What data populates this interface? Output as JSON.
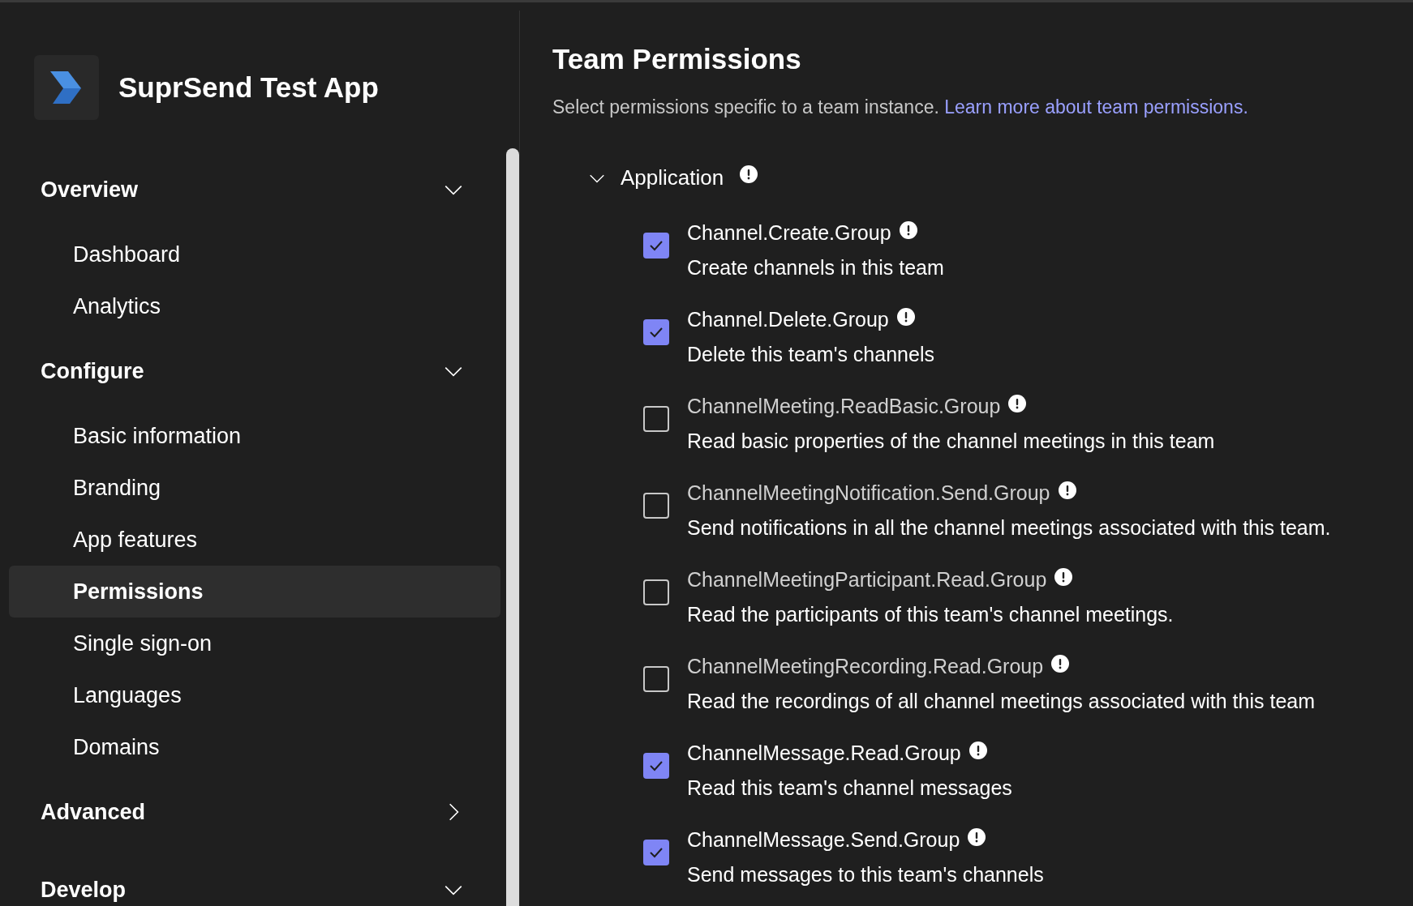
{
  "app": {
    "name": "SuprSend Test App"
  },
  "sidebar": {
    "sections": [
      {
        "label": "Overview",
        "expanded": true,
        "items": [
          {
            "label": "Dashboard",
            "selected": false
          },
          {
            "label": "Analytics",
            "selected": false
          }
        ]
      },
      {
        "label": "Configure",
        "expanded": true,
        "items": [
          {
            "label": "Basic information",
            "selected": false
          },
          {
            "label": "Branding",
            "selected": false
          },
          {
            "label": "App features",
            "selected": false
          },
          {
            "label": "Permissions",
            "selected": true
          },
          {
            "label": "Single sign-on",
            "selected": false
          },
          {
            "label": "Languages",
            "selected": false
          },
          {
            "label": "Domains",
            "selected": false
          }
        ]
      },
      {
        "label": "Advanced",
        "expanded": false
      },
      {
        "label": "Develop",
        "expanded": true
      }
    ]
  },
  "main": {
    "title": "Team Permissions",
    "description": "Select permissions specific to a team instance.",
    "link": "Learn more about team permissions.",
    "group": {
      "label": "Application",
      "expanded": true,
      "permissions": [
        {
          "name": "Channel.Create.Group",
          "description": "Create channels in this team",
          "checked": true
        },
        {
          "name": "Channel.Delete.Group",
          "description": "Delete this team's channels",
          "checked": true
        },
        {
          "name": "ChannelMeeting.ReadBasic.Group",
          "description": "Read basic properties of the channel meetings in this team",
          "checked": false
        },
        {
          "name": "ChannelMeetingNotification.Send.Group",
          "description": "Send notifications in all the channel meetings associated with this team.",
          "checked": false
        },
        {
          "name": "ChannelMeetingParticipant.Read.Group",
          "description": "Read the participants of this team's channel meetings.",
          "checked": false
        },
        {
          "name": "ChannelMeetingRecording.Read.Group",
          "description": "Read the recordings of all channel meetings associated with this team",
          "checked": false
        },
        {
          "name": "ChannelMessage.Read.Group",
          "description": "Read this team's channel messages",
          "checked": true
        },
        {
          "name": "ChannelMessage.Send.Group",
          "description": "Send messages to this team's channels",
          "checked": true
        }
      ]
    }
  }
}
